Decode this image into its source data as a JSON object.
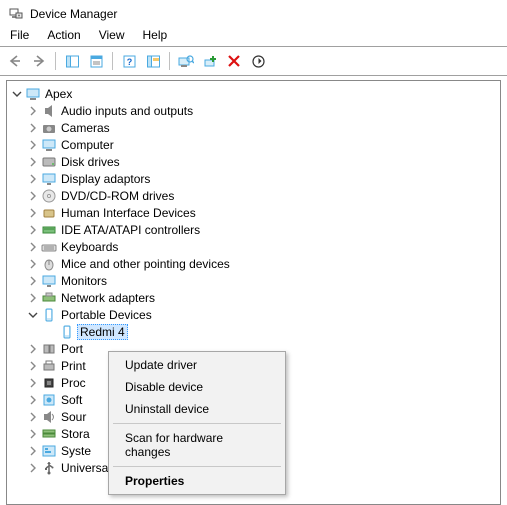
{
  "window": {
    "title": "Device Manager"
  },
  "menubar": {
    "file": "File",
    "action": "Action",
    "view": "View",
    "help": "Help"
  },
  "tree": {
    "root": "Apex",
    "selected_device": "Redmi 4",
    "nodes": [
      {
        "label": "Audio inputs and outputs",
        "icon": "speaker"
      },
      {
        "label": "Cameras",
        "icon": "camera"
      },
      {
        "label": "Computer",
        "icon": "computer"
      },
      {
        "label": "Disk drives",
        "icon": "disk"
      },
      {
        "label": "Display adaptors",
        "icon": "display"
      },
      {
        "label": "DVD/CD-ROM drives",
        "icon": "cd"
      },
      {
        "label": "Human Interface Devices",
        "icon": "hid"
      },
      {
        "label": "IDE ATA/ATAPI controllers",
        "icon": "ide"
      },
      {
        "label": "Keyboards",
        "icon": "keyboard"
      },
      {
        "label": "Mice and other pointing devices",
        "icon": "mouse"
      },
      {
        "label": "Monitors",
        "icon": "monitor"
      },
      {
        "label": "Network adapters",
        "icon": "network"
      },
      {
        "label": "Portable Devices",
        "expanded": true,
        "icon": "portable"
      },
      {
        "label": "Ports",
        "truncated": "Port",
        "icon": "ports"
      },
      {
        "label": "Print queues",
        "truncated": "Print",
        "icon": "print"
      },
      {
        "label": "Processors",
        "truncated": "Proc",
        "icon": "cpu"
      },
      {
        "label": "Software devices",
        "truncated": "Soft",
        "icon": "software"
      },
      {
        "label": "Sound, video and game controllers",
        "truncated": "Sour",
        "icon": "sound"
      },
      {
        "label": "Storage controllers",
        "truncated": "Stora",
        "icon": "storage"
      },
      {
        "label": "System devices",
        "truncated": "Syste",
        "icon": "system"
      },
      {
        "label": "Universal Serial Bus controllers",
        "icon": "usb"
      }
    ]
  },
  "context_menu": {
    "update": "Update driver",
    "disable": "Disable device",
    "uninstall": "Uninstall device",
    "scan": "Scan for hardware changes",
    "properties": "Properties"
  }
}
